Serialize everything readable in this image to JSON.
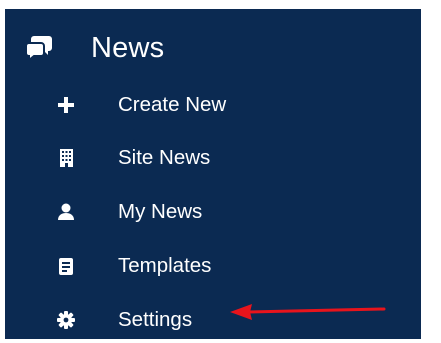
{
  "nav": {
    "title": "News",
    "title_icon": "chat-bubbles-icon",
    "items": [
      {
        "label": "Create New",
        "icon": "plus-icon"
      },
      {
        "label": "Site News",
        "icon": "building-icon"
      },
      {
        "label": "My News",
        "icon": "user-icon"
      },
      {
        "label": "Templates",
        "icon": "document-icon"
      },
      {
        "label": "Settings",
        "icon": "gear-icon"
      }
    ]
  },
  "colors": {
    "panel_bg": "#0b2a52",
    "text": "#ffffff",
    "annotation_arrow": "#e8141c"
  }
}
